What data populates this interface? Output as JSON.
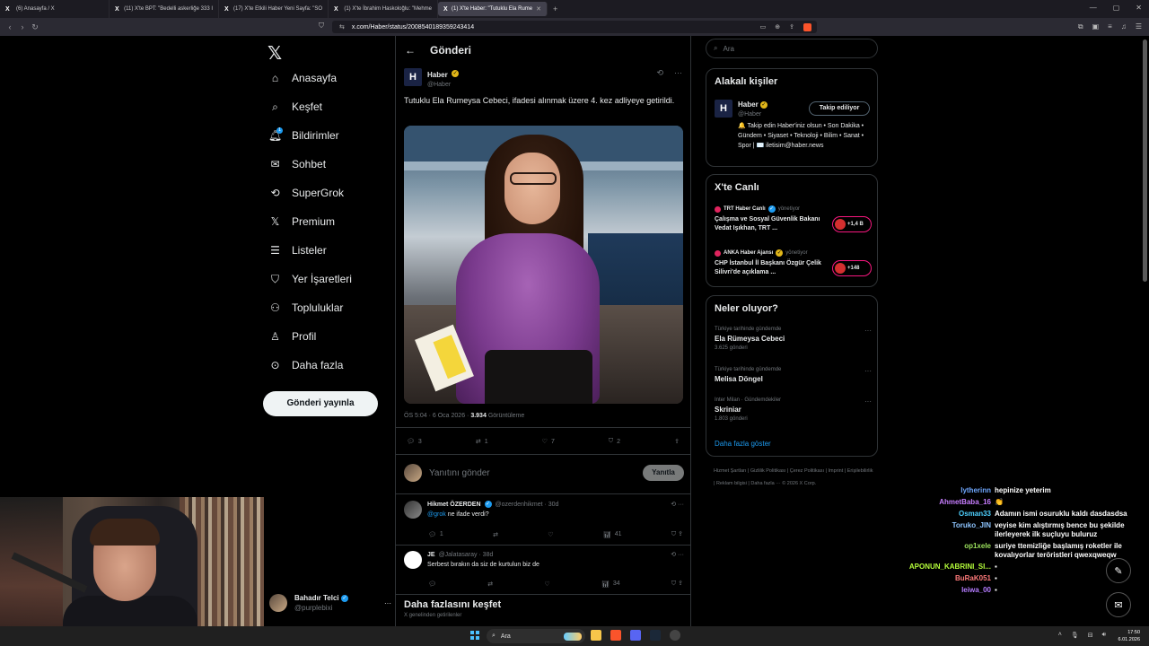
{
  "browser": {
    "tabs": [
      {
        "title": "(6) Anasayfa / X",
        "active": false
      },
      {
        "title": "(11) X'te BPT: \"Bedelli askerliğe 333 I",
        "active": false
      },
      {
        "title": "(17) X'te Etkili Haber Yeni Sayfa: \"SO",
        "active": false
      },
      {
        "title": "(1) X'te İbrahim Haskoloğlu: \"Mehme",
        "active": false
      },
      {
        "title": "(1) X'te Haber: \"Tutuklu Ela Rume",
        "active": true
      }
    ],
    "url": "x.com/Haber/status/2008540189359243414"
  },
  "nav": {
    "items": [
      {
        "label": "Anasayfa",
        "icon": "home-icon"
      },
      {
        "label": "Keşfet",
        "icon": "search-icon"
      },
      {
        "label": "Bildirimler",
        "icon": "bell-icon",
        "badge": "1"
      },
      {
        "label": "Sohbet",
        "icon": "mail-icon"
      },
      {
        "label": "SuperGrok",
        "icon": "grok-icon"
      },
      {
        "label": "Premium",
        "icon": "x-icon"
      },
      {
        "label": "Listeler",
        "icon": "list-icon"
      },
      {
        "label": "Yer İşaretleri",
        "icon": "bookmark-icon"
      },
      {
        "label": "Topluluklar",
        "icon": "people-icon"
      },
      {
        "label": "Profil",
        "icon": "person-icon"
      },
      {
        "label": "Daha fazla",
        "icon": "more-circle-icon"
      }
    ],
    "post_button": "Gönderi yayınla",
    "account": {
      "name": "Bahadır Telci",
      "handle": "@purplebixi"
    }
  },
  "main": {
    "header": "Gönderi",
    "tweet": {
      "name": "Haber",
      "handle": "@Haber",
      "logo": "H",
      "text": "Tutuklu Ela Rumeysa Cebeci, ifadesi alınmak üzere 4. kez adliyeye getirildi.",
      "time": "ÖS 5:04 · 6 Oca 2026 ·",
      "views": "3.934",
      "views_label": "Görüntüleme",
      "replies": "3",
      "reposts": "1",
      "likes": "7",
      "bookmarks": "2"
    },
    "reply_placeholder": "Yanıtını gönder",
    "reply_button": "Yanıtla",
    "replies": [
      {
        "name": "Hikmet ÖZERDEN",
        "handle": "@ozerdenhikmet · 30d",
        "mention": "@grok",
        "text": "ne ifade verdi?",
        "reply_count": "1",
        "views": "41"
      },
      {
        "name": "JE",
        "handle": "@Jalatasaray · 38d",
        "mention": "",
        "text": "Serbest bırakın da siz de kurtulun biz de",
        "reply_count": "",
        "views": "34"
      }
    ],
    "explore_title": "Daha fazlasını keşfet",
    "explore_sub": "X genelinden getirilenler"
  },
  "right": {
    "search_placeholder": "Ara",
    "related": {
      "title": "Alakalı kişiler",
      "name": "Haber",
      "handle": "@Haber",
      "follow": "Takip ediliyor",
      "bio": "🔔 Takip edin Haber'iniz olsun • Son Dakika • Gündem • Siyaset • Teknoloji • Bilim • Sanat • Spor | ✉️ iletisim@haber.news"
    },
    "live": {
      "title": "X'te Canlı",
      "items": [
        {
          "source": "TRT Haber Canlı",
          "managed": "yönetiyor",
          "title": "Çalışma ve Sosyal Güvenlik Bakanı Vedat Işıkhan, TRT ...",
          "count": "+1,4 B"
        },
        {
          "source": "ANKA Haber Ajansı",
          "managed": "yönetiyor",
          "title": "CHP İstanbul İl Başkanı Özgür Çelik Silivri'de açıklama ...",
          "count": "+148"
        }
      ]
    },
    "trends": {
      "title": "Neler oluyor?",
      "items": [
        {
          "context": "Türkiye tarihinde gündemde",
          "name": "Ela Rümeysa Cebeci",
          "count": "3.625 gönderi"
        },
        {
          "context": "Türkiye tarihinde gündemde",
          "name": "Melisa Döngel",
          "count": ""
        },
        {
          "context": "Inter Milan · Gündemdekiler",
          "name": "Skriniar",
          "count": "1.803 gönderi"
        }
      ],
      "show_more": "Daha fazla göster"
    },
    "footer": "Hizmet Şartları | Gizlilik Politikası | Çerez Politikası | Imprint | Erişilebilirlik | Reklam bilgisi | Daha fazla ··· © 2026 X Corp."
  },
  "chat": [
    {
      "user": "lytherinn",
      "color": "#6fa8ff",
      "text": "hepinize yeterim"
    },
    {
      "user": "AhmetBaba_16",
      "color": "#c77dff",
      "text": "👏"
    },
    {
      "user": "Osman33",
      "color": "#4fd1ff",
      "text": "Adamın ismi osuruklu kaldı dasdasdsa"
    },
    {
      "user": "Toruko_JIN",
      "color": "#8ec5ff",
      "text": "veyise kim alıştırmış bence bu şekilde ilerleyerek ilk suçluyu buluruz"
    },
    {
      "user": "op1xele",
      "color": "#9be15d",
      "text": "suriye ttemizliğe başlamış roketler ile kovalıyorlar teröristleri qwexqweqw"
    },
    {
      "user": "APONUN_KABRINI_SI...",
      "color": "#b6ff3b",
      "text": "▪"
    },
    {
      "user": "BuRaK051",
      "color": "#ff7a7a",
      "text": "▪"
    },
    {
      "user": "leiwa_00",
      "color": "#b57cff",
      "text": "▪"
    }
  ],
  "taskbar": {
    "search": "Ara",
    "time": "17:50",
    "date": "6.01.2026"
  }
}
